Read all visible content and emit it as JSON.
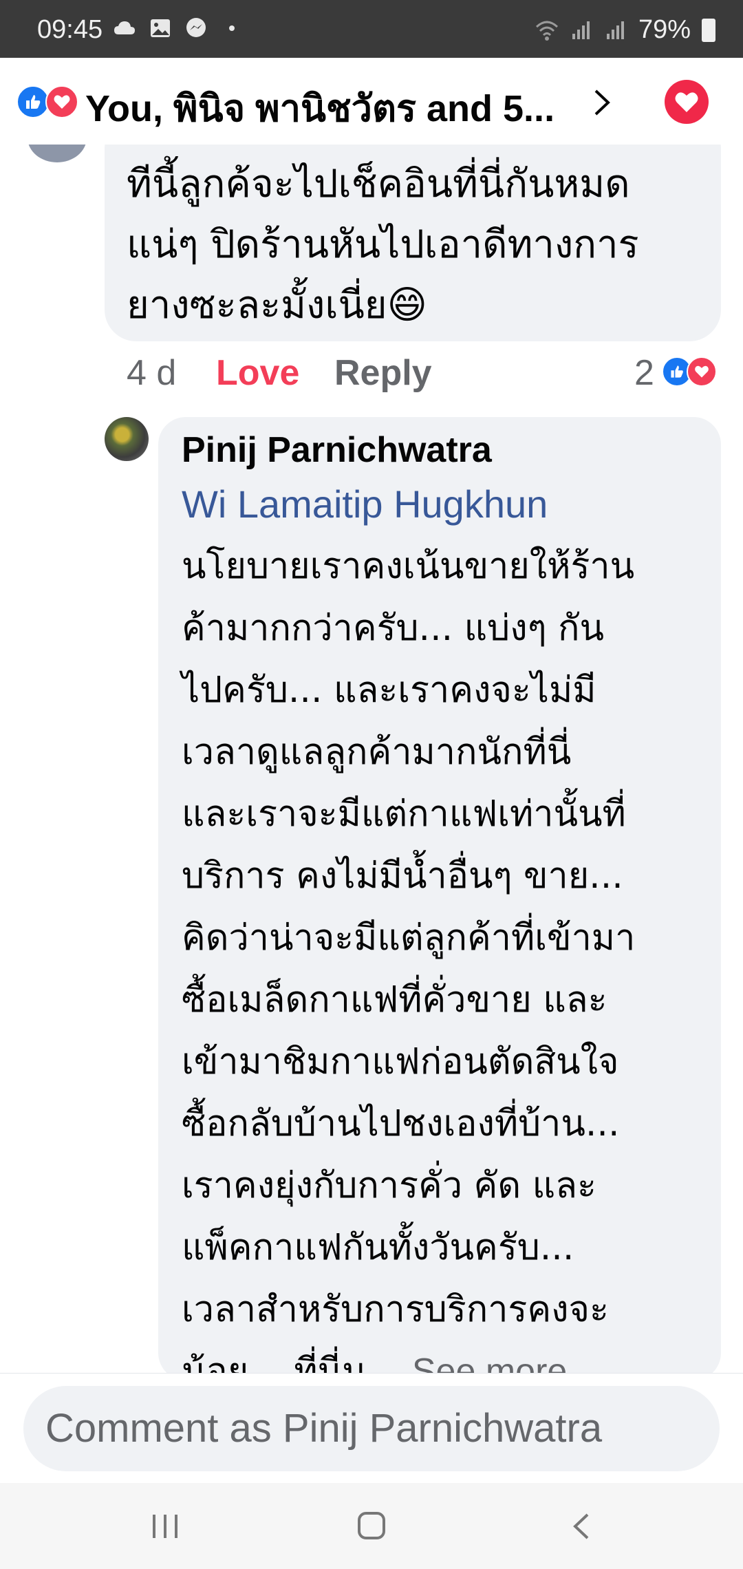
{
  "status_bar": {
    "time": "09:45",
    "battery": "79%",
    "icons": [
      "cloud-icon",
      "image-icon",
      "messenger-icon",
      "dot-icon",
      "wifi-icon",
      "signal-icon",
      "signal-icon",
      "battery-icon"
    ]
  },
  "header": {
    "title": "You, พินิจ พานิชวัตร and 5...",
    "reaction_icons": [
      "like-icon",
      "love-icon"
    ],
    "colors": {
      "like": "#1877f2",
      "love": "#f33e58"
    }
  },
  "comment": {
    "lines": [
      "ทีนี้ลูกค้จะไปเช็คอินที่นี่กันหมด",
      "แน่ๆ ปิดร้านหันไปเอาดีทางการ",
      "ยางซะละมั้งเนี่ย😄"
    ],
    "time": "4 d",
    "love_label": "Love",
    "reply_label": "Reply",
    "reaction_count": "2"
  },
  "reply": {
    "author": "Pinij Parnichwatra",
    "mention": "Wi Lamaitip Hugkhun",
    "lines": [
      "นโยบายเราคงเน้นขายให้ร้าน",
      "ค้ามากกว่าครับ... แบ่งๆ กัน",
      "ไปครับ... และเราคงจะไม่มี",
      "เวลาดูแลลูกค้ามากนักที่นี่",
      "และเราจะมีแต่กาแฟเท่านั้นที่",
      "บริการ คงไม่มีน้ำอื่นๆ ขาย...",
      "คิดว่าน่าจะมีแต่ลูกค้าที่เข้ามา",
      "ซื้อเมล็ดกาแฟที่คั่วขาย และ",
      "เข้ามาชิมกาแฟก่อนตัดสินใจ",
      "ซื้อกลับบ้านไปชงเองที่บ้าน...",
      "เราคงยุ่งกับการคั่ว คัด และ",
      "แพ็คกาแฟกันทั้งวันครับ...",
      "เวลาสำหรับการบริการคงจะ"
    ],
    "last_line": "น้อย... ที่นี่น...",
    "see_more": "See more"
  },
  "composer": {
    "placeholder": "Comment as Pinij Parnichwatra"
  },
  "nav": {
    "icons": [
      "recents-icon",
      "home-icon",
      "back-icon"
    ]
  }
}
